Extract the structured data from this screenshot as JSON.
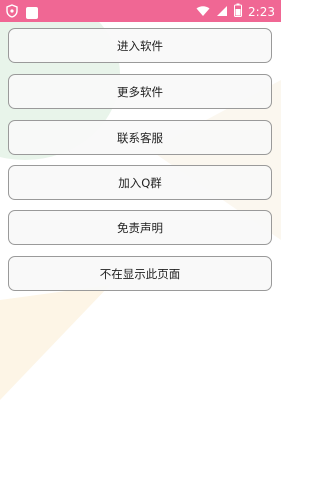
{
  "status_bar": {
    "time": "2:23",
    "color": "#f06794",
    "icons": [
      "shield-icon",
      "notification-square-icon",
      "wifi-icon",
      "signal-icon",
      "battery-icon"
    ]
  },
  "menu": {
    "buttons": [
      {
        "label": "进入软件"
      },
      {
        "label": "更多软件"
      },
      {
        "label": "联系客服"
      },
      {
        "label": "加入Q群"
      },
      {
        "label": "免责声明"
      },
      {
        "label": "不在显示此页面"
      }
    ]
  }
}
